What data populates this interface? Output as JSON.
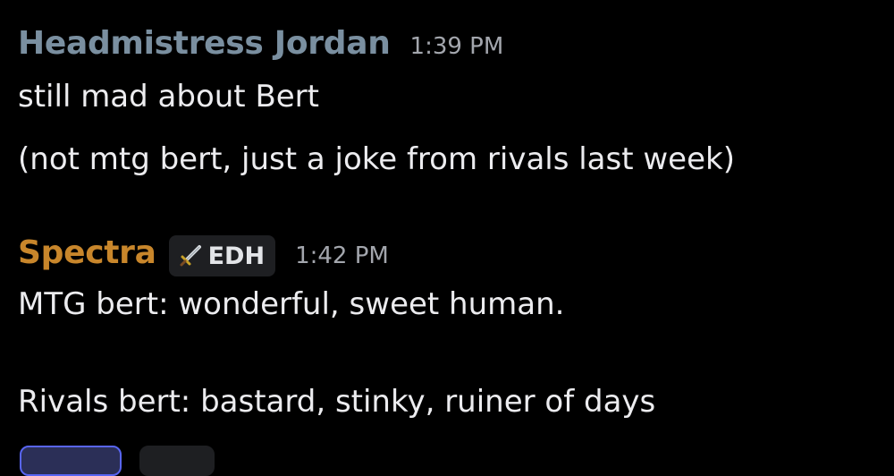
{
  "messages": [
    {
      "username": "Headmistress Jordan",
      "username_color": "#7a8fa0",
      "timestamp": "1:39 PM",
      "lines": [
        "still mad about Bert",
        "(not mtg bert, just a joke from rivals last week)"
      ]
    },
    {
      "username": "Spectra",
      "username_color": "#c8862b",
      "tag": {
        "icon": "sword-icon",
        "label": "EDH"
      },
      "timestamp": "1:42 PM",
      "lines": [
        "MTG bert: wonderful, sweet human.",
        "",
        "Rivals bert: bastard, stinky, ruiner of days"
      ]
    }
  ],
  "colors": {
    "background": "#000000",
    "text": "#ececef",
    "timestamp": "#a3a6ad",
    "tag_background": "#1e1f22",
    "reaction_selected_border": "#5865f2"
  }
}
